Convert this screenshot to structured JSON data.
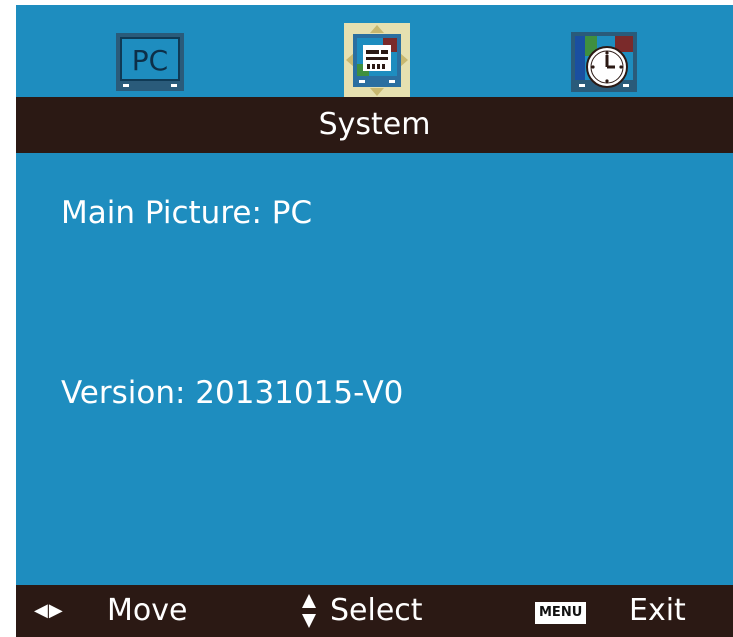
{
  "menu": {
    "tabs": [
      {
        "id": "pc",
        "label": "PC",
        "icon": "pc-monitor-icon",
        "selected": false
      },
      {
        "id": "system",
        "icon": "system-settings-icon",
        "selected": true
      },
      {
        "id": "time",
        "icon": "clock-icon",
        "selected": false
      }
    ],
    "title": "System"
  },
  "content": {
    "main_picture": "Main Picture: PC",
    "version": "Version: 20131015-V0"
  },
  "footer": {
    "move_label": "Move",
    "select_label": "Select",
    "menu_badge": "MENU",
    "exit_label": "Exit"
  },
  "colors": {
    "background": "#1e8dbf",
    "bar": "#2b1914",
    "selected_tab_frame": "#e6e0b0",
    "text": "#ffffff"
  }
}
